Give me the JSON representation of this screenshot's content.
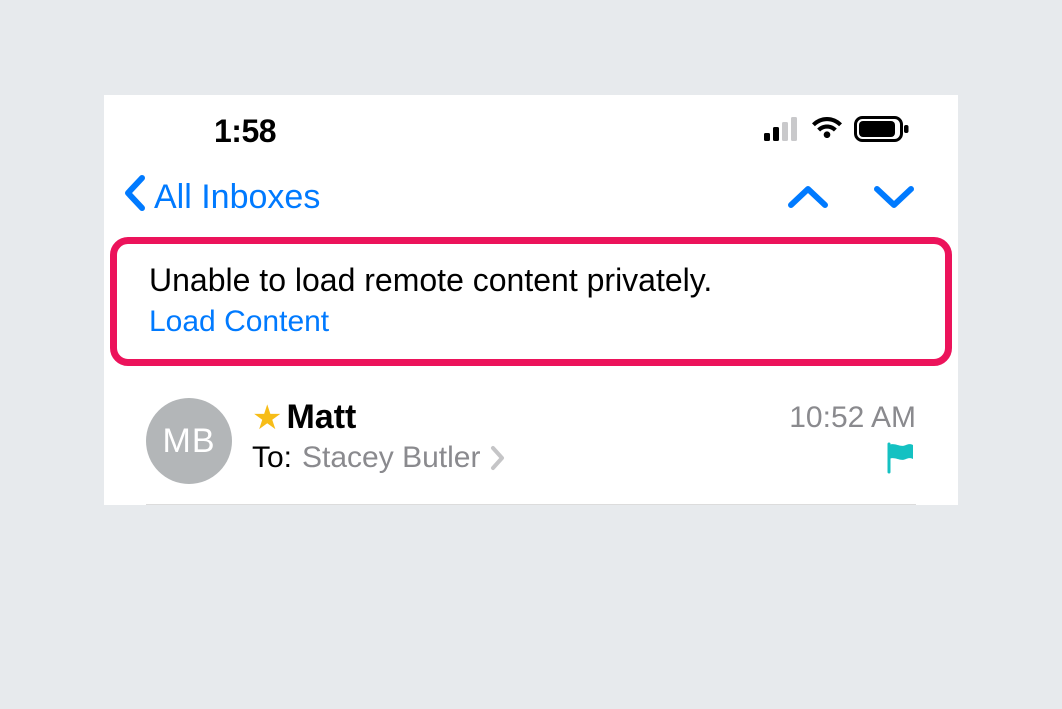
{
  "status": {
    "time": "1:58"
  },
  "nav": {
    "back_label": "All Inboxes"
  },
  "banner": {
    "message": "Unable to load remote content privately.",
    "action": "Load Content"
  },
  "message": {
    "avatar_initials": "MB",
    "sender": "Matt",
    "time": "10:52 AM",
    "to_label": "To:",
    "to_name": "Stacey Butler"
  }
}
